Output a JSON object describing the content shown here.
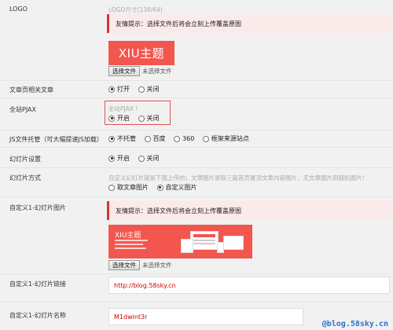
{
  "logo": {
    "label": "LOGO",
    "size_hint": "LOGO尺寸(138/64)",
    "notice": "友情提示：选择文件后将会立刻上传覆盖原图",
    "image_text": "XIU主题",
    "file_button": "选择文件",
    "no_file": "未选择文件"
  },
  "related_posts": {
    "label": "文章页相关文章",
    "options": [
      "打开",
      "关闭"
    ],
    "selected": 0
  },
  "pjax": {
    "label": "全站PJAX",
    "hint": "全站PJAX !",
    "options": [
      "开启",
      "关闭"
    ],
    "selected": 0,
    "highlight_color": "#e05252"
  },
  "js_hosting": {
    "label": "JS文件托管（可大幅提速JS加载）",
    "options": [
      "不托管",
      "百度",
      "360",
      "框架来源站点"
    ],
    "selected": 0
  },
  "slider_setting": {
    "label": "幻灯片设置",
    "options": [
      "开启",
      "关闭"
    ],
    "selected": 0
  },
  "slider_mode": {
    "label": "幻灯片方式",
    "hint": "自定义幻灯片就是下面上传的；文章图片是取三篇首页置顶文章内容图片，无文章图片则随机图片！",
    "options": [
      "取文章图片",
      "自定义图片"
    ],
    "selected": 1
  },
  "slider1_image": {
    "label": "自定义1-幻灯片图片",
    "notice": "友情提示：选择文件后将会立刻上传覆盖原图",
    "banner_title": "XIU主题",
    "file_button": "选择文件",
    "no_file": "未选择文件"
  },
  "slider1_link": {
    "label": "自定义1-幻灯片链接",
    "value": "http://blog.58sky.cn"
  },
  "slider1_name": {
    "label": "自定义1-幻灯片名称",
    "value": "M1dwint3r"
  },
  "watermark": "@blog.58sky.cn",
  "colors": {
    "accent_red": "#f2564f",
    "notice_border": "#dc3232",
    "input_text": "#cc0000"
  }
}
